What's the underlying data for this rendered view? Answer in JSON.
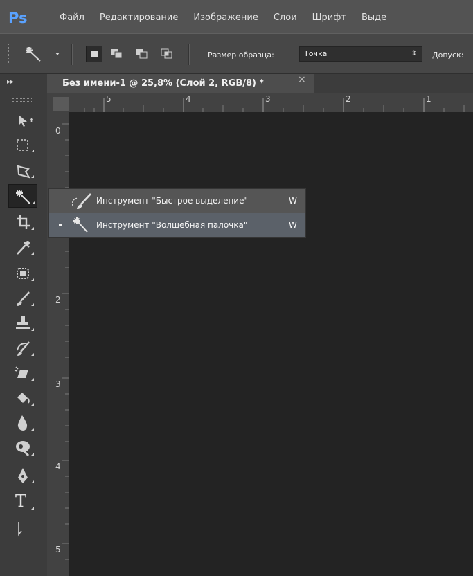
{
  "app": {
    "logo": "Ps"
  },
  "menu": {
    "items": [
      "Файл",
      "Редактирование",
      "Изображение",
      "Слои",
      "Шрифт",
      "Выде"
    ]
  },
  "options": {
    "sample_size_label": "Размер образца:",
    "sample_size_value": "Точка",
    "tolerance_label": "Допуск:",
    "tool_icon": "magic-wand-icon"
  },
  "document": {
    "tab_title": "Без имени-1 @ 25,8% (Слой 2, RGB/8) *",
    "close_glyph": "×"
  },
  "rulers": {
    "horizontal": [
      "5",
      "4",
      "3",
      "2",
      "1"
    ],
    "vertical": [
      "0",
      "2",
      "3",
      "4",
      "5"
    ]
  },
  "tools": [
    "move-tool-icon",
    "marquee-tool-icon",
    "lasso-tool-icon",
    "magic-wand-tool-icon",
    "crop-tool-icon",
    "eyedropper-tool-icon",
    "healing-brush-tool-icon",
    "brush-tool-icon",
    "stamp-tool-icon",
    "history-brush-tool-icon",
    "eraser-tool-icon",
    "paint-bucket-tool-icon",
    "blur-tool-icon",
    "dodge-tool-icon",
    "pen-tool-icon",
    "type-tool-icon",
    "path-selection-tool-icon"
  ],
  "type_tool_glyph": "T",
  "flyout": {
    "items": [
      {
        "label": "Инструмент \"Быстрое выделение\"",
        "shortcut": "W",
        "icon": "quick-selection-icon",
        "active": false
      },
      {
        "label": "Инструмент \"Волшебная палочка\"",
        "shortcut": "W",
        "icon": "magic-wand-icon",
        "active": true
      }
    ]
  },
  "colors": {
    "accent": "#5aa2ff",
    "canvas": "#232323",
    "toolbar": "#3c3c3c",
    "menubar": "#535353"
  }
}
